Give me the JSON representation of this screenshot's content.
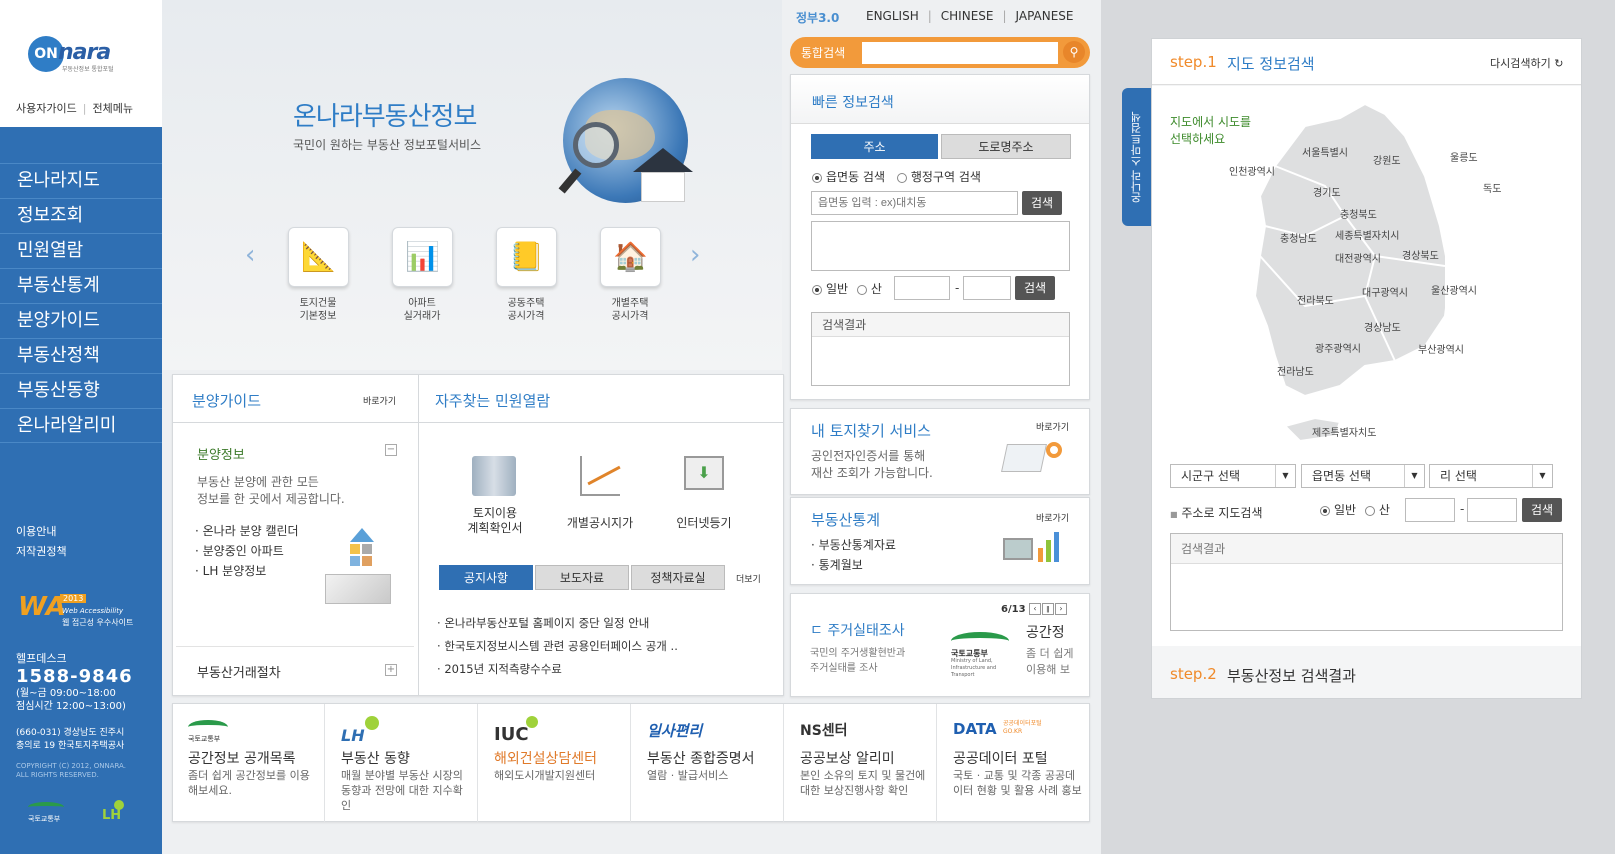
{
  "sidebar": {
    "logo_text": "nara",
    "logo_prefix": "ON",
    "logo_sub": "부동산정보 통합포털",
    "guide_link": "사용자가이드",
    "all_menu_link": "전체메뉴",
    "menu": [
      "온나라지도",
      "정보조회",
      "민원열람",
      "부동산통계",
      "분양가이드",
      "부동산정책",
      "부동산동향",
      "온나라알리미"
    ],
    "info_links": [
      "이용안내",
      "저작권정책"
    ],
    "wa_badge": {
      "mark": "WA",
      "year": "2013",
      "line1": "Web Accessibility",
      "line2": "웹 접근성 우수사이트"
    },
    "helpdesk": {
      "label": "헬프데스크",
      "number": "1588-9846",
      "hours": "(월~금 09:00~18:00",
      "lunch": "점심시간 12:00~13:00)"
    },
    "address": [
      "(660-031) 경상남도 진주시",
      "충의로 19 한국토지주택공사"
    ],
    "copyright": [
      "COPYRIGHT (C) 2012, ONNARA.",
      "ALL RIGHTS RESERVED."
    ],
    "bottom_logos": [
      "국토교통부",
      "LH"
    ]
  },
  "hero": {
    "title": "온나라부동산정보",
    "subtitle": "국민이 원하는 부동산 정보포털서비스",
    "quick_links": [
      {
        "line1": "토지건물",
        "line2": "기본정보",
        "icon": "ruler-icon"
      },
      {
        "line1": "아파트",
        "line2": "실거래가",
        "icon": "bar-chart-icon"
      },
      {
        "line1": "공동주택",
        "line2": "공시가격",
        "icon": "notebook-icon"
      },
      {
        "line1": "개별주택",
        "line2": "공시가격",
        "icon": "house-icon"
      }
    ]
  },
  "header": {
    "gov_logo": "정부3.0",
    "languages": [
      "ENGLISH",
      "CHINESE",
      "JAPANESE"
    ],
    "search_label": "통합검색",
    "search_placeholder": ""
  },
  "bunyang": {
    "title": "분양가이드",
    "more": "바로가기",
    "sub_title": "분양정보",
    "desc1": "부동산 분양에 관한 모든",
    "desc2": "정보를 한 곳에서 제공합니다.",
    "items": [
      "온나라 분양 캘린더",
      "분양중인 아파트",
      "LH 분양정보"
    ],
    "footer_title": "부동산거래절차"
  },
  "minwon": {
    "title": "자주찾는 민원열람",
    "services": [
      {
        "line1": "토지이용",
        "line2": "계획확인서"
      },
      {
        "line1": "개별공시지가",
        "line2": ""
      },
      {
        "line1": "인터넷등기",
        "line2": ""
      }
    ],
    "tabs": [
      "공지사항",
      "보도자료",
      "정책자료실"
    ],
    "more": "더보기",
    "notices": [
      "온나라부동산포털 홈페이지 중단 일정 안내",
      "한국토지정보시스템 관련 공용인터페이스 공개 ..",
      "2015년 지적측량수수료"
    ]
  },
  "quick_search": {
    "title": "빠른 정보검색",
    "tabs": [
      "주소",
      "도로명주소"
    ],
    "radio_options": [
      "읍면동 검색",
      "행정구역 검색"
    ],
    "input_placeholder": "읍면동 입력 : ex)대치동",
    "search_btn": "검색",
    "type_options": [
      "일반",
      "산"
    ],
    "result_label": "검색결과"
  },
  "my_land": {
    "title": "내 토지찾기 서비스",
    "more": "바로가기",
    "desc1": "공인전자인증서를 통해",
    "desc2": "재산 조회가 가능합니다."
  },
  "stats": {
    "title": "부동산통계",
    "more": "바로가기",
    "items": [
      "부동산통계자료",
      "통계월보"
    ]
  },
  "banner": {
    "counter": "6/13",
    "title": "주거실태조사",
    "title_prefix": "ㄷ",
    "desc1": "국민의 주거생활현반과",
    "desc2": "주거실태를 조사",
    "logo": "국토교통부",
    "logo_sub": "Ministry of Land, Infrastructure and Transport",
    "next_title": "공간정",
    "next_desc1": "좀 더 쉽게",
    "next_desc2": "이용해 보"
  },
  "partners": [
    {
      "logo": "국토교통부",
      "title": "공간정보 공개목록",
      "desc": "좀더 쉽게 공간정보를 이용해보세요."
    },
    {
      "logo": "LH",
      "title": "부동산 동향",
      "desc": "매월 분야별 부동산 시장의 동향과 전망에 대한 지수확인"
    },
    {
      "logo": "IUC",
      "title": "해외건설상담센터",
      "desc": "해외도시개발지원센터"
    },
    {
      "logo": "일사편리",
      "title": "부동산 종합증명서",
      "desc": "열람 · 발급서비스"
    },
    {
      "logo": "NS센터",
      "title": "공공보상 알리미",
      "desc": "본인 소유의 토지 및 물건에 대한 보상진행사항 확인"
    },
    {
      "logo": "DATA",
      "logo_sub": "공공데이터포털 GO.KR",
      "title": "공공데이터 포털",
      "desc": "국토 · 교통 및 각종 공공데이터 현황 및 활용 사례 홍보"
    }
  ],
  "map": {
    "step1_label": "step.1",
    "step1_title": "지도 정보검색",
    "reset": "다시검색하기",
    "prompt1": "지도에서 시도를",
    "prompt2": "선택하세요",
    "side_tab": "온나라 스마트검색",
    "regions": [
      "서울특별시",
      "강원도",
      "울릉도",
      "독도",
      "인천광역시",
      "경기도",
      "충청북도",
      "세종특별자치시",
      "충청남도",
      "대전광역시",
      "경상북도",
      "대구광역시",
      "울산광역시",
      "전라북도",
      "경상남도",
      "광주광역시",
      "부산광역시",
      "전라남도",
      "제주특별자치도"
    ],
    "selects": [
      "시군구 선택",
      "읍면동 선택",
      "리 선택"
    ],
    "addr_search": "주소로 지도검색",
    "type_options": [
      "일반",
      "산"
    ],
    "search_btn": "검색",
    "result_label": "검색결과",
    "step2_label": "step.2",
    "step2_title": "부동산정보 검색결과"
  },
  "colors": {
    "primary": "#2f6fb3",
    "accent": "#f29a3b",
    "step": "#f08a2a"
  }
}
